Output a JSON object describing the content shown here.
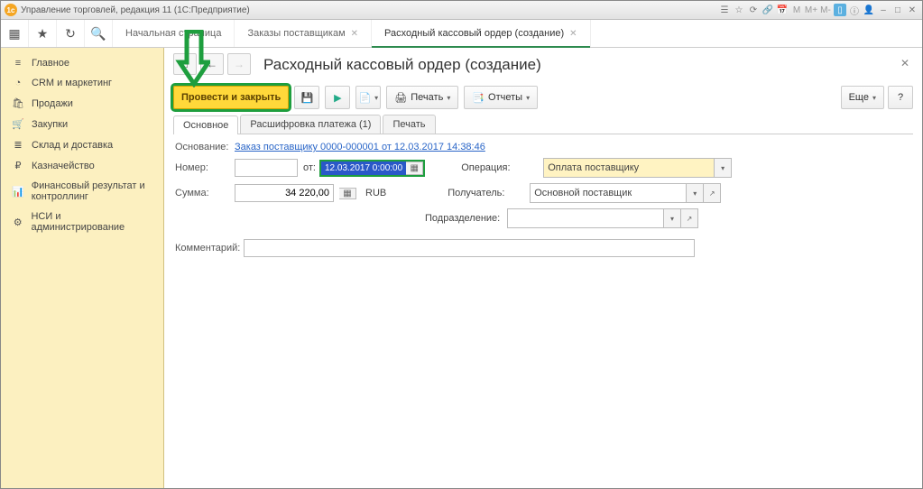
{
  "window": {
    "title": "Управление торговлей, редакция 11  (1С:Предприятие)"
  },
  "app_tabs": [
    {
      "label": "Начальная страница",
      "closable": false
    },
    {
      "label": "Заказы поставщикам",
      "closable": true
    },
    {
      "label": "Расходный кассовый ордер (создание)",
      "closable": true,
      "active": true
    }
  ],
  "sidebar": {
    "items": [
      {
        "icon": "≡",
        "label": "Главное"
      },
      {
        "icon": "◔",
        "label": "CRM и маркетинг"
      },
      {
        "icon": "🛍",
        "label": "Продажи"
      },
      {
        "icon": "🛒",
        "label": "Закупки"
      },
      {
        "icon": "≣",
        "label": "Склад и доставка"
      },
      {
        "icon": "₽",
        "label": "Казначейство"
      },
      {
        "icon": "📊",
        "label": "Финансовый результат и контроллинг"
      },
      {
        "icon": "⚙",
        "label": "НСИ и администрирование"
      }
    ]
  },
  "page": {
    "title": "Расходный кассовый ордер (создание)",
    "toolbar": {
      "post_close": "Провести и закрыть",
      "print": "Печать",
      "reports": "Отчеты",
      "more": "Еще"
    },
    "subtabs": [
      {
        "label": "Основное",
        "active": true
      },
      {
        "label": "Расшифровка платежа (1)"
      },
      {
        "label": "Печать"
      }
    ]
  },
  "form": {
    "basis_label": "Основание:",
    "basis_link": "Заказ поставщику 0000-000001 от 12.03.2017 14:38:46",
    "number_label": "Номер:",
    "number_value": "",
    "from_label": "от:",
    "date_value": "12.03.2017  0:00:00",
    "operation_label": "Операция:",
    "operation_value": "Оплата поставщику",
    "sum_label": "Сумма:",
    "sum_value": "34 220,00",
    "currency": "RUB",
    "payee_label": "Получатель:",
    "payee_value": "Основной поставщик",
    "division_label": "Подразделение:",
    "division_value": "",
    "comment_label": "Комментарий:"
  }
}
